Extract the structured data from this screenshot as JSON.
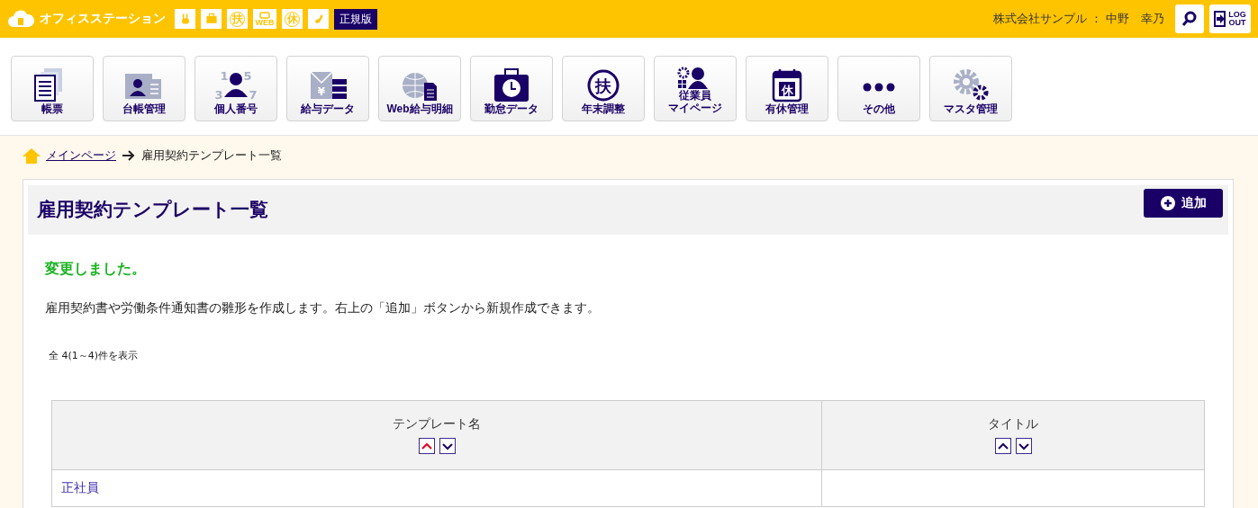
{
  "header": {
    "app_name": "オフィスステーション",
    "quick_icons": [
      {
        "kind": "rabbit"
      },
      {
        "kind": "briefcase"
      },
      {
        "kind": "glyph",
        "text": "扶"
      },
      {
        "kind": "web",
        "text": "WEB"
      },
      {
        "kind": "glyph",
        "text": "休"
      },
      {
        "kind": "phone"
      }
    ],
    "edition": "正規版",
    "user": "株式会社サンプル ： 中野　幸乃",
    "logout_lines": [
      "LOG",
      "OUT"
    ]
  },
  "nav": [
    {
      "label": "帳票",
      "kind": "documents"
    },
    {
      "label": "台帳管理",
      "kind": "idcard"
    },
    {
      "label": "個人番号",
      "kind": "numbers",
      "icon_text": [
        "1",
        "5",
        "3",
        "7"
      ]
    },
    {
      "label": "給与データ",
      "kind": "yen",
      "icon_text": [
        "¥"
      ]
    },
    {
      "label": "Web給与明細",
      "kind": "globe"
    },
    {
      "label": "勤怠データ",
      "kind": "clock"
    },
    {
      "label": "年末調整",
      "kind": "glyph",
      "icon_text": [
        "扶"
      ]
    },
    {
      "label_lines": [
        "従業員",
        "マイページ"
      ],
      "kind": "employee"
    },
    {
      "label": "有休管理",
      "kind": "calendar",
      "icon_text": [
        "休"
      ]
    },
    {
      "label": "その他",
      "kind": "dots"
    },
    {
      "label": "マスタ管理",
      "kind": "gears"
    }
  ],
  "breadcrumb": {
    "home": "メインページ",
    "current": "雇用契約テンプレート一覧"
  },
  "page": {
    "title": "雇用契約テンプレート一覧",
    "add_button": "追加",
    "message": "変更しました。",
    "description": "雇用契約書や労働条件通知書の雛形を作成します。右上の「追加」ボタンから新規作成できます。",
    "count": "全 4(1～4)件を表示"
  },
  "table": {
    "columns": [
      {
        "label": "テンプレート名",
        "sorted_ascending": true
      },
      {
        "label": "タイトル",
        "sorted_ascending": false
      }
    ],
    "rows": [
      [
        "正社員",
        ""
      ]
    ]
  }
}
